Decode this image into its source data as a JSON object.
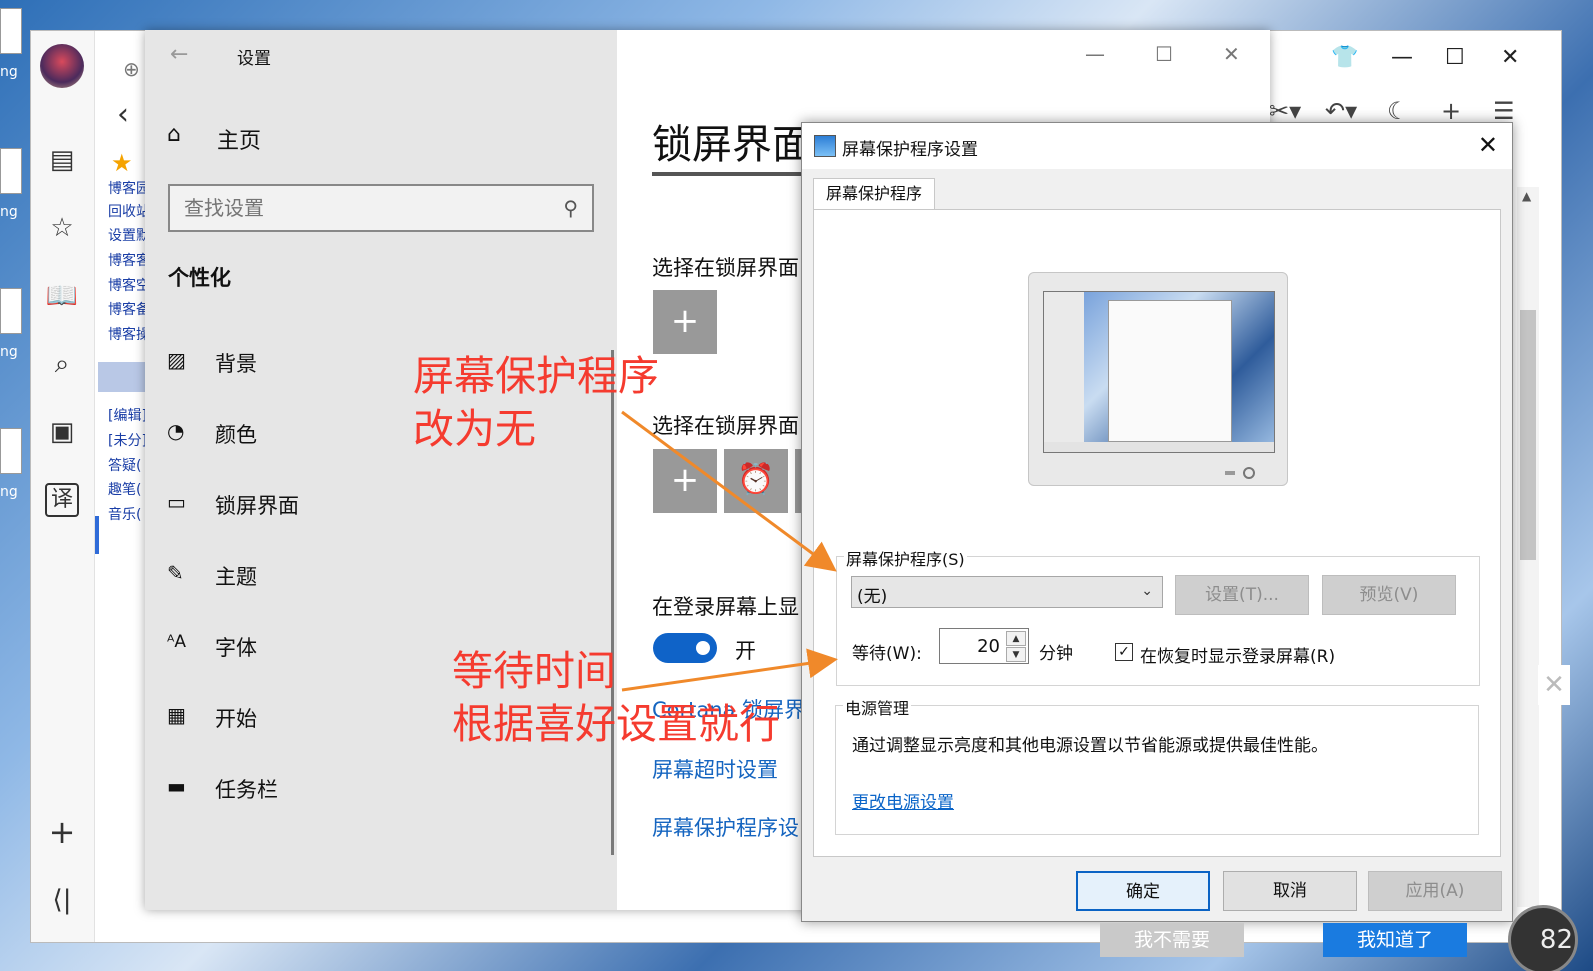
{
  "desktop": {
    "icon_labels": [
      "ng",
      "ng",
      "ng",
      "ng"
    ]
  },
  "browser": {
    "sidebar_icons": [
      "profile-avatar",
      "news-icon",
      "star-icon",
      "book-icon",
      "search-icon",
      "video-icon",
      "translate-icon",
      "add-icon",
      "collapse-icon"
    ],
    "translate_glyph": "译",
    "bookmark_links": [
      "博客园",
      "回收站",
      "设置默",
      "博客客",
      "博客空",
      "博客备",
      "博客操"
    ],
    "lower_links": [
      "[编辑]",
      "[未分]",
      "答疑(",
      "趣笔(",
      "音乐("
    ],
    "popup_buttons": {
      "no": "我不需要",
      "yes": "我知道了"
    },
    "gauge_value": "82"
  },
  "settings": {
    "title": "设置",
    "home": "主页",
    "search_placeholder": "查找设置",
    "category": "个性化",
    "nav": [
      {
        "label": "背景",
        "icon": "picture-icon"
      },
      {
        "label": "颜色",
        "icon": "palette-icon"
      },
      {
        "label": "锁屏界面",
        "icon": "lock-screen-icon"
      },
      {
        "label": "主题",
        "icon": "theme-icon"
      },
      {
        "label": "字体",
        "icon": "font-icon"
      },
      {
        "label": "开始",
        "icon": "start-icon"
      },
      {
        "label": "任务栏",
        "icon": "taskbar-icon"
      }
    ],
    "page_title": "锁屏界面",
    "section_lock_app": "选择在锁屏界面",
    "section_lock_status": "选择在锁屏界面",
    "login_bg": "在登录屏幕上显",
    "toggle_label": "开",
    "cortana_link": "Cortana 锁屏界",
    "timeout_link": "屏幕超时设置",
    "screensaver_link": "屏幕保护程序设"
  },
  "annotations": {
    "a1_line1": "屏幕保护程序",
    "a1_line2": "改为无",
    "a2_line1": "等待时间",
    "a2_line2": "根据喜好设置就行"
  },
  "dialog": {
    "title": "屏幕保护程序设置",
    "tab": "屏幕保护程序",
    "group_saver": "屏幕保护程序(S)",
    "saver_value": "(无)",
    "settings_btn": "设置(T)...",
    "preview_btn": "预览(V)",
    "wait_label": "等待(W):",
    "wait_value": "20",
    "minutes": "分钟",
    "resume_checkbox": "在恢复时显示登录屏幕(R)",
    "resume_checked": true,
    "power_group": "电源管理",
    "power_desc": "通过调整显示亮度和其他电源设置以节省能源或提供最佳性能。",
    "power_link": "更改电源设置",
    "ok": "确定",
    "cancel": "取消",
    "apply": "应用(A)"
  },
  "colors": {
    "accent": "#0f63c8",
    "annotation": "#f53b2f",
    "link": "#1565c0"
  }
}
